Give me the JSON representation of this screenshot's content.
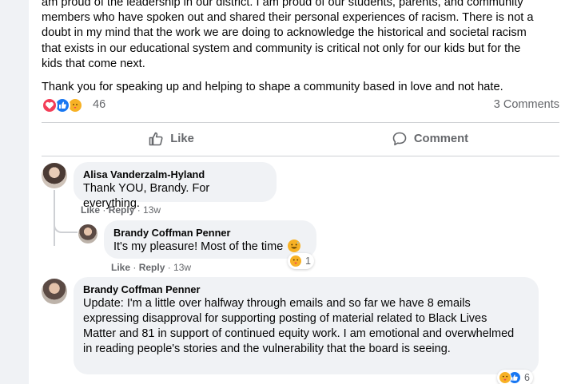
{
  "post": {
    "paragraph1_lines": [
      "am proud of the leadership in our district. I am proud of our students, parents, and community",
      "members who have spoken out and shared their personal experiences of racism. There is not a",
      "doubt in my mind that the work we are doing to acknowledge the historical and societal racism",
      "that exists in our educational system and community is critical not only for our kids but for the",
      "kids that come next."
    ],
    "paragraph2": "Thank you for speaking up and helping to shape a community based in love and not hate.",
    "reaction_count": "46",
    "comments_count": "3 Comments",
    "reaction_icons": [
      "love-icon",
      "like-icon",
      "care-icon"
    ]
  },
  "actions": {
    "like_label": "Like",
    "comment_label": "Comment"
  },
  "comments": [
    {
      "author": "Alisa Vanderzalm-Hyland",
      "text": "Thank YOU, Brandy. For everything.",
      "like": "Like",
      "reply": "Reply",
      "time": "13w"
    },
    {
      "author": "Brandy Coffman Penner",
      "text": "It's my pleasure! Most of the time",
      "like": "Like",
      "reply": "Reply",
      "time": "13w",
      "reaction_count": "1"
    },
    {
      "author": "Brandy Coffman Penner",
      "text": "Update: I'm a little over halfway through emails and so far we have 8 emails expressing disapproval for supporting posting of material related to Black Lives Matter and 81 in support of continued equity work. I am emotional and overwhelmed in reading people's stories and the vulnerability that the board is seeing.",
      "reaction_count": "6"
    }
  ],
  "colors": {
    "page_bg": "#f0f2f5",
    "card_bg": "#ffffff",
    "bubble_bg": "#f0f2f5",
    "secondary_text": "#65676b",
    "like_blue": "#1877f2",
    "love_red": "#f33e58",
    "care_yellow": "#f7b125"
  }
}
